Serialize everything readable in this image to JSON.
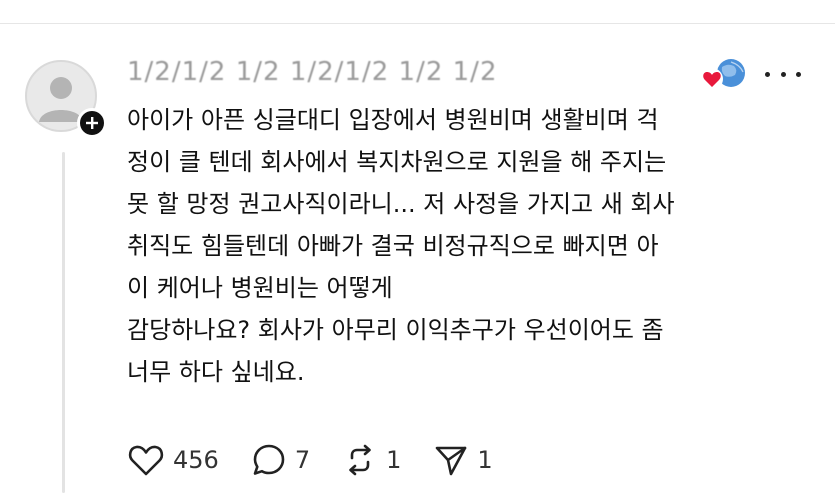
{
  "post": {
    "username": "1/2/1/2 1/2 1/2/1/2 1/2 1/2",
    "body_paragraphs": [
      "아이가 아픈 싱글대디 입장에서 병원비며 생활비며 걱\n정이 클 텐데 회사에서 복지차원으로 지원을 해 주지는\n못 할 망정 권고사직이라니... 저 사정을 가지고 새 회사\n취직도 힘들텐데 아빠가 결국 비정규직으로 빠지면 아\n이 케어나 병원비는 어떻게",
      "감당하나요? 회사가 아무리 이익추구가 우선이어도 좀\n너무 하다 싶네요."
    ]
  },
  "actions": {
    "likes": "456",
    "comments": "7",
    "reposts": "1",
    "shares": "1"
  },
  "icons": {
    "avatar": "default-user-avatar",
    "follow": "plus-icon",
    "reactions": "heart-and-globe-reaction-icons",
    "more": "ellipsis-icon",
    "like": "heart-outline-icon",
    "comment": "speech-bubble-icon",
    "repost": "repost-icon",
    "share": "paper-plane-icon"
  },
  "colors": {
    "reaction_heart": "#e8193c",
    "reaction_globe": "#4a90d9",
    "text": "#111111",
    "muted_text": "#9a9a9a"
  }
}
